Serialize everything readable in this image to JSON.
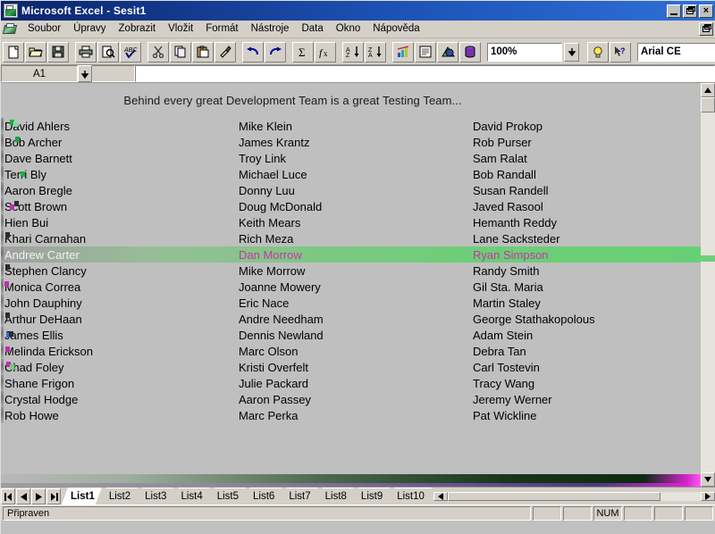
{
  "window": {
    "title": "Microsoft Excel - Sesit1",
    "app_icon": "excel-icon",
    "minimize_label": "",
    "restore_label": "",
    "close_label": "×",
    "doc_restore_label": ""
  },
  "menubar": {
    "doc_icon": "excel-document-icon",
    "items": [
      {
        "label": "Soubor"
      },
      {
        "label": "Úpravy"
      },
      {
        "label": "Zobrazit"
      },
      {
        "label": "Vložit"
      },
      {
        "label": "Formát"
      },
      {
        "label": "Nástroje"
      },
      {
        "label": "Data"
      },
      {
        "label": "Okno"
      },
      {
        "label": "Nápověda"
      }
    ]
  },
  "toolbar": {
    "buttons": [
      {
        "name": "new-icon",
        "tip": "New"
      },
      {
        "name": "open-folder-icon",
        "tip": "Open"
      },
      {
        "name": "save-floppy-icon",
        "tip": "Save"
      },
      {
        "name": "print-icon",
        "tip": "Print"
      },
      {
        "name": "print-preview-icon",
        "tip": "Print Preview"
      },
      {
        "name": "spellcheck-abc-icon",
        "tip": "Spelling"
      },
      {
        "name": "cut-scissors-icon",
        "tip": "Cut"
      },
      {
        "name": "copy-icon",
        "tip": "Copy"
      },
      {
        "name": "paste-clipboard-icon",
        "tip": "Paste"
      },
      {
        "name": "format-painter-brush-icon",
        "tip": "Format Painter"
      },
      {
        "name": "undo-arrow-icon",
        "tip": "Undo"
      },
      {
        "name": "redo-arrow-icon",
        "tip": "Redo"
      },
      {
        "name": "autosum-sigma-icon",
        "tip": "AutoSum"
      },
      {
        "name": "function-fx-icon",
        "tip": "Function Wizard"
      },
      {
        "name": "sort-ascending-icon",
        "tip": "Sort Ascending"
      },
      {
        "name": "sort-descending-icon",
        "tip": "Sort Descending"
      },
      {
        "name": "chart-wizard-icon",
        "tip": "Chart Wizard"
      },
      {
        "name": "text-box-icon",
        "tip": "Text Box"
      },
      {
        "name": "drawing-icon",
        "tip": "Drawing"
      },
      {
        "name": "map-icon",
        "tip": "Map"
      }
    ],
    "zoom_value": "100%",
    "zoom_dropdown_icon": "chevron-down-icon",
    "tip-wizard-icon": "lightbulb-icon",
    "help-icon": "help-arrow-icon",
    "font_value": "Arial CE"
  },
  "formulabar": {
    "name_box_value": "A1",
    "name_box_dropdown_icon": "chevron-down-icon",
    "formula_value": ""
  },
  "sheet": {
    "banner": "Behind every great Development Team is a great Testing Team...",
    "selected_row_index": 8,
    "selection_bg_color": "#6cce76",
    "selection_text_color": "#cc33aa",
    "rows": [
      {
        "c1": "David Ahlers",
        "c2": "Mike Klein",
        "c3": "David Prokop"
      },
      {
        "c1": "Bob Archer",
        "c2": "James Krantz",
        "c3": "Rob Purser"
      },
      {
        "c1": "Dave Barnett",
        "c2": "Troy Link",
        "c3": "Sam Ralat"
      },
      {
        "c1": "Terri Bly",
        "c2": "Michael Luce",
        "c3": "Bob Randall"
      },
      {
        "c1": "Aaron Bregle",
        "c2": "Donny Luu",
        "c3": "Susan Randell"
      },
      {
        "c1": "Scott Brown",
        "c2": "Doug McDonald",
        "c3": "Javed Rasool"
      },
      {
        "c1": "Hien Bui",
        "c2": "Keith Mears",
        "c3": "Hemanth Reddy"
      },
      {
        "c1": "Khari Carnahan",
        "c2": "Rich Meza",
        "c3": "Lane Sacksteder"
      },
      {
        "c1": "Andrew Carter",
        "c2": "Dan Morrow",
        "c3": "Ryan Simpson"
      },
      {
        "c1": "Stephen Clancy",
        "c2": "Mike Morrow",
        "c3": "Randy Smith"
      },
      {
        "c1": "Monica Correa",
        "c2": "Joanne Mowery",
        "c3": "Gil Sta. Maria"
      },
      {
        "c1": "John Dauphiny",
        "c2": "Eric Nace",
        "c3": "Martin Staley"
      },
      {
        "c1": "Arthur DeHaan",
        "c2": "Andre Needham",
        "c3": "George Stathakopolous"
      },
      {
        "c1": "James Ellis",
        "c2": "Dennis Newland",
        "c3": "Adam Stein"
      },
      {
        "c1": "Melinda Erickson",
        "c2": "Marc Olson",
        "c3": "Debra Tan"
      },
      {
        "c1": "Chad Foley",
        "c2": "Kristi Overfelt",
        "c3": "Carl Tostevin"
      },
      {
        "c1": "Shane Frigon",
        "c2": "Julie Packard",
        "c3": "Tracy Wang"
      },
      {
        "c1": "Crystal Hodge",
        "c2": "Aaron Passey",
        "c3": "Jeremy Werner"
      },
      {
        "c1": "Rob Howe",
        "c2": "Marc Perka",
        "c3": "Pat Wickline"
      }
    ]
  },
  "scrollbars": {
    "v_up_icon": "triangle-up-icon",
    "v_down_icon": "triangle-down-icon",
    "h_left_icon": "triangle-left-icon",
    "h_right_icon": "triangle-right-icon"
  },
  "tabbar": {
    "nav": [
      {
        "name": "tab-nav-first",
        "icon": "nav-first-icon"
      },
      {
        "name": "tab-nav-prev",
        "icon": "nav-prev-icon"
      },
      {
        "name": "tab-nav-next",
        "icon": "nav-next-icon"
      },
      {
        "name": "tab-nav-last",
        "icon": "nav-last-icon"
      }
    ],
    "tabs": [
      {
        "label": "List1",
        "active": true
      },
      {
        "label": "List2",
        "active": false
      },
      {
        "label": "List3",
        "active": false
      },
      {
        "label": "List4",
        "active": false
      },
      {
        "label": "List5",
        "active": false
      },
      {
        "label": "List6",
        "active": false
      },
      {
        "label": "List7",
        "active": false
      },
      {
        "label": "List8",
        "active": false
      },
      {
        "label": "List9",
        "active": false
      },
      {
        "label": "List10",
        "active": false
      }
    ]
  },
  "statusbar": {
    "message": "Připraven",
    "indicators": [
      "",
      "",
      "NUM",
      "",
      "",
      ""
    ]
  }
}
